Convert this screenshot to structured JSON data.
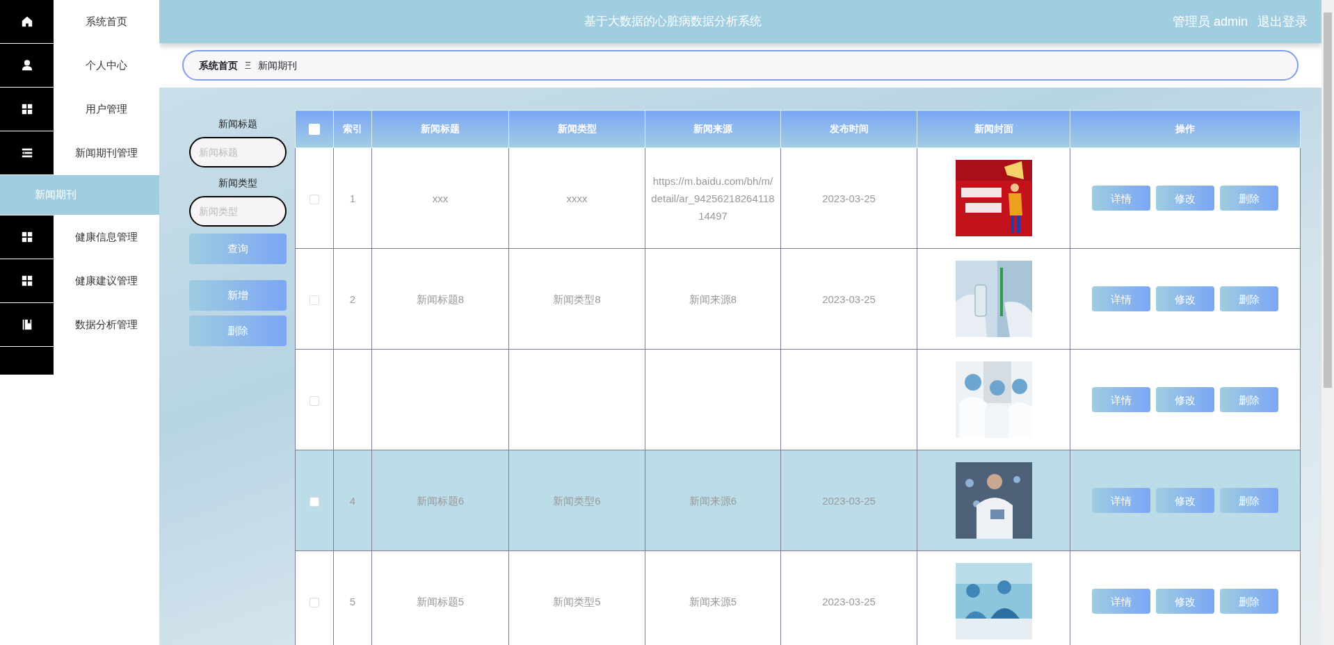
{
  "sidebar": {
    "items": [
      {
        "label": "系统首页",
        "kind": "home",
        "selected": false
      },
      {
        "label": "个人中心",
        "kind": "person",
        "selected": false
      },
      {
        "label": "用户管理",
        "kind": "grid",
        "selected": false
      },
      {
        "label": "新闻期刊管理",
        "kind": "list",
        "selected": false,
        "expanded": true,
        "children": [
          {
            "label": "新闻期刊",
            "selected": true
          }
        ]
      },
      {
        "label": "健康信息管理",
        "kind": "grid",
        "selected": false
      },
      {
        "label": "健康建议管理",
        "kind": "grid",
        "selected": false
      },
      {
        "label": "数据分析管理",
        "kind": "book",
        "selected": false
      }
    ]
  },
  "header": {
    "title": "基于大数据的心脏病数据分析系统",
    "user": "管理员 admin",
    "logout": "退出登录"
  },
  "breadcrumb": {
    "home": "系统首页",
    "separator": "Ξ",
    "current": "新闻期刊"
  },
  "filters": [
    {
      "label": "新闻标题",
      "placeholder": "新闻标题"
    },
    {
      "label": "新闻类型",
      "placeholder": "新闻类型"
    }
  ],
  "search_button": "查询",
  "action_buttons": [
    "新增",
    "删除"
  ],
  "table": {
    "all_checked": false,
    "columns": [
      "索引",
      "新闻标题",
      "新闻类型",
      "新闻来源",
      "发布时间",
      "新闻封面",
      "操作"
    ],
    "rows": [
      {
        "index": "1",
        "title": "xxx",
        "type": "xxxx",
        "source": "https://m.baidu.com/bh/m/detail/ar_9425621826411814497",
        "date": "2023-03-25",
        "checked": false,
        "selected": false,
        "buttons": [
          "详情",
          "修改",
          "删除"
        ]
      },
      {
        "index": "2",
        "title": "新闻标题8",
        "type": "新闻类型8",
        "source": "新闻来源8",
        "date": "2023-03-25",
        "checked": false,
        "selected": false,
        "buttons": [
          "详情",
          "修改",
          "删除"
        ]
      },
      {
        "checked": false,
        "selected": false,
        "buttons": [
          "详情",
          "修改",
          "删除"
        ]
      },
      {
        "index": "4",
        "title": "新闻标题6",
        "type": "新闻类型6",
        "source": "新闻来源6",
        "date": "2023-03-25",
        "checked": false,
        "selected": true,
        "buttons": [
          "详情",
          "修改",
          "删除"
        ]
      },
      {
        "index": "5",
        "title": "新闻标题5",
        "type": "新闻类型5",
        "source": "新闻来源5",
        "date": "2023-03-25",
        "checked": false,
        "selected": false,
        "buttons": [
          "详情",
          "修改",
          "删除"
        ]
      }
    ]
  }
}
